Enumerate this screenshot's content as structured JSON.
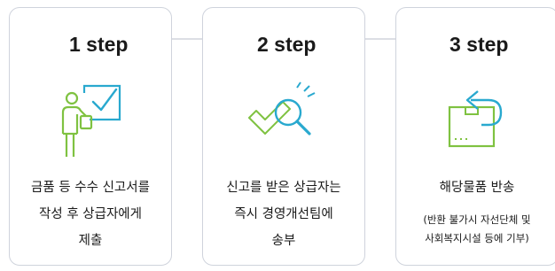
{
  "steps": [
    {
      "title": "1 step",
      "icon": "presenter-checkbox-icon",
      "lines": [
        "금품 등 수수 신고서를",
        "작성 후 상급자에게",
        "제출"
      ]
    },
    {
      "title": "2 step",
      "icon": "magnifier-check-icon",
      "lines": [
        "신고를 받은 상급자는",
        "즉시 경영개선팀에",
        "송부"
      ]
    },
    {
      "title": "3 step",
      "icon": "return-box-icon",
      "lines": [
        "해당물품 반송"
      ],
      "note": [
        "(반환 불가시 자선단체 및",
        "사회복지시설 등에 기부)"
      ]
    }
  ],
  "colors": {
    "accent": "#7fc241",
    "border": "#cfd3dc",
    "arrow": "#b9bec9",
    "text": "#1a1a1a"
  }
}
